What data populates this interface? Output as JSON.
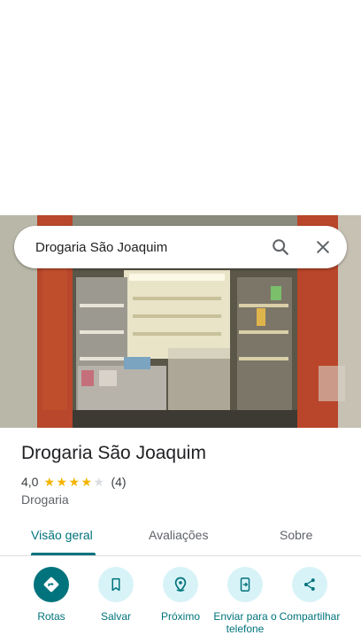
{
  "search": {
    "query": "Drogaria São Joaquim"
  },
  "place": {
    "name": "Drogaria São Joaquim",
    "rating": "4,0",
    "stars_filled": 4,
    "stars_total": 5,
    "review_count": "(4)",
    "category": "Drogaria"
  },
  "tabs": [
    {
      "label": "Visão geral",
      "active": true
    },
    {
      "label": "Avaliações",
      "active": false
    },
    {
      "label": "Sobre",
      "active": false
    }
  ],
  "actions": [
    {
      "label": "Rotas",
      "icon": "directions-icon"
    },
    {
      "label": "Salvar",
      "icon": "bookmark-icon"
    },
    {
      "label": "Próximo",
      "icon": "nearby-icon"
    },
    {
      "label": "Enviar para o telefone",
      "icon": "send-to-phone-icon"
    },
    {
      "label": "Compartilhar",
      "icon": "share-icon"
    }
  ],
  "colors": {
    "accent": "#00737c",
    "action_bg": "#d8f3f8",
    "star": "#f5b400"
  }
}
